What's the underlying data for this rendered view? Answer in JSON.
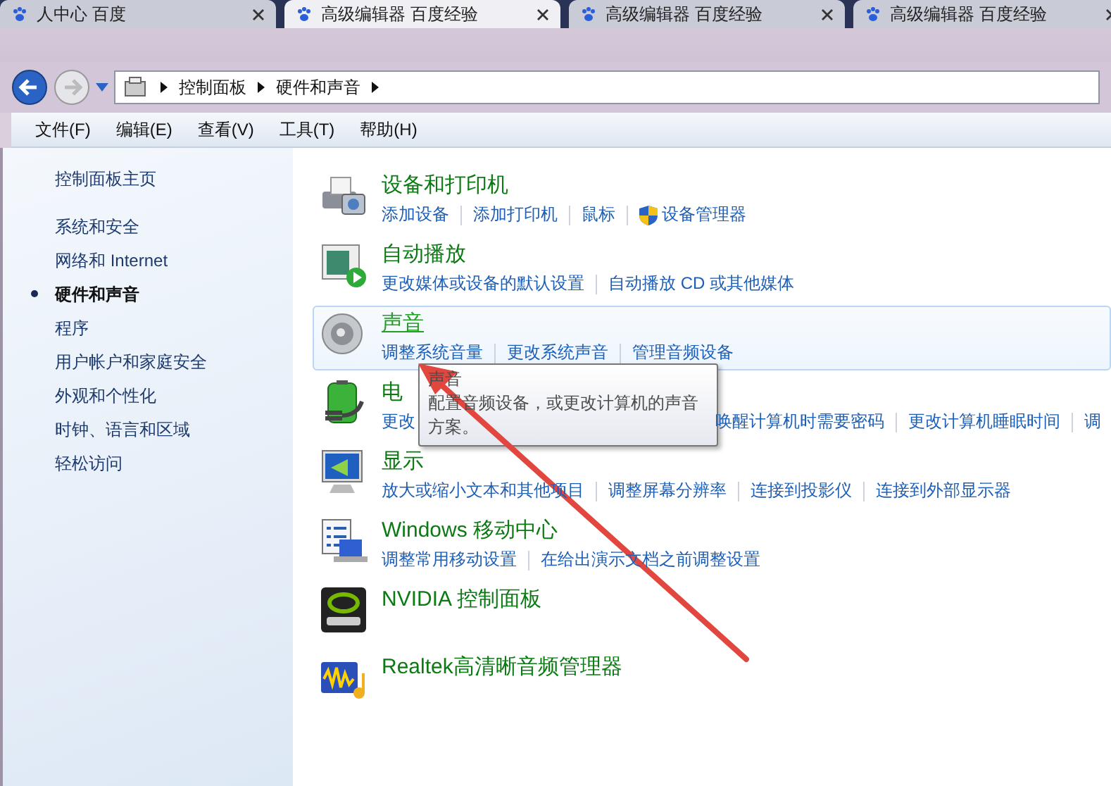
{
  "browser_tabs": [
    {
      "label": "人中心 百度",
      "selected": false
    },
    {
      "label": "高级编辑器 百度经验",
      "selected": true
    },
    {
      "label": "高级编辑器 百度经验",
      "selected": false
    },
    {
      "label": "高级编辑器 百度经验",
      "selected": false
    }
  ],
  "address_bar": {
    "breadcrumb": [
      "控制面板",
      "硬件和声音"
    ]
  },
  "menu": [
    "文件(F)",
    "编辑(E)",
    "查看(V)",
    "工具(T)",
    "帮助(H)"
  ],
  "sidebar": {
    "home": "控制面板主页",
    "items": [
      {
        "label": "系统和安全",
        "selected": false
      },
      {
        "label": "网络和 Internet",
        "selected": false
      },
      {
        "label": "硬件和声音",
        "selected": true
      },
      {
        "label": "程序",
        "selected": false
      },
      {
        "label": "用户帐户和家庭安全",
        "selected": false
      },
      {
        "label": "外观和个性化",
        "selected": false
      },
      {
        "label": "时钟、语言和区域",
        "selected": false
      },
      {
        "label": "轻松访问",
        "selected": false
      }
    ]
  },
  "categories": [
    {
      "kind": "printer",
      "title": "设备和打印机",
      "highlighted": false,
      "covered": false,
      "links": [
        {
          "label": "添加设备",
          "shield": false
        },
        {
          "label": "添加打印机",
          "shield": false
        },
        {
          "label": "鼠标",
          "shield": false
        },
        {
          "label": "设备管理器",
          "shield": true
        }
      ]
    },
    {
      "kind": "autoplay",
      "title": "自动播放",
      "highlighted": false,
      "covered": false,
      "links": [
        {
          "label": "更改媒体或设备的默认设置",
          "shield": false
        },
        {
          "label": "自动播放 CD 或其他媒体",
          "shield": false
        }
      ]
    },
    {
      "kind": "speaker",
      "title": "声音",
      "highlighted": true,
      "covered": false,
      "links": [
        {
          "label": "调整系统音量",
          "shield": false
        },
        {
          "label": "更改系统声音",
          "shield": false
        },
        {
          "label": "管理音频设备",
          "shield": false
        }
      ]
    },
    {
      "kind": "battery",
      "title": "电",
      "highlighted": false,
      "covered": true,
      "links": [
        {
          "label": "更改",
          "shield": false
        },
        {
          "label": "唤醒计算机时需要密码",
          "shield": false
        },
        {
          "label": "更改计算机睡眠时间",
          "shield": false
        },
        {
          "label": "调",
          "shield": false
        }
      ]
    },
    {
      "kind": "monitor",
      "title": "显示",
      "highlighted": false,
      "covered": false,
      "links": [
        {
          "label": "放大或缩小文本和其他项目",
          "shield": false
        },
        {
          "label": "调整屏幕分辨率",
          "shield": false
        },
        {
          "label": "连接到投影仪",
          "shield": false
        },
        {
          "label": "连接到外部显示器",
          "shield": false
        }
      ]
    },
    {
      "kind": "mobility",
      "title": "Windows 移动中心",
      "highlighted": false,
      "covered": false,
      "links": [
        {
          "label": "调整常用移动设置",
          "shield": false
        },
        {
          "label": "在给出演示文档之前调整设置",
          "shield": false
        }
      ]
    },
    {
      "kind": "nvidia",
      "title": "NVIDIA 控制面板",
      "highlighted": false
    },
    {
      "kind": "realtek",
      "title": "Realtek高清晰音频管理器",
      "highlighted": false
    }
  ],
  "tooltip": {
    "title": "声音",
    "text": "配置音频设备，或更改计算机的声音方案。"
  }
}
